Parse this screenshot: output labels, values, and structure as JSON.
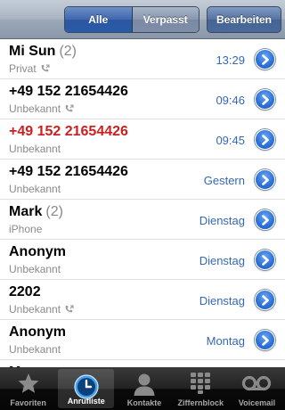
{
  "navbar": {
    "segment_all": "Alle",
    "segment_missed": "Verpasst",
    "edit_label": "Bearbeiten"
  },
  "calls": [
    {
      "name": "Mi Sun",
      "count": "(2)",
      "label": "Privat",
      "time": "13:29",
      "missed": false,
      "outgoing": true
    },
    {
      "name": "+49 152 21654426",
      "count": "",
      "label": "Unbekannt",
      "time": "09:46",
      "missed": false,
      "outgoing": true
    },
    {
      "name": "+49 152 21654426",
      "count": "",
      "label": "Unbekannt",
      "time": "09:45",
      "missed": true,
      "outgoing": false
    },
    {
      "name": "+49 152 21654426",
      "count": "",
      "label": "Unbekannt",
      "time": "Gestern",
      "missed": false,
      "outgoing": false
    },
    {
      "name": "Mark",
      "count": "(2)",
      "label": "iPhone",
      "time": "Dienstag",
      "missed": false,
      "outgoing": false
    },
    {
      "name": "Anonym",
      "count": "",
      "label": "Unbekannt",
      "time": "Dienstag",
      "missed": false,
      "outgoing": false
    },
    {
      "name": "2202",
      "count": "",
      "label": "Unbekannt",
      "time": "Dienstag",
      "missed": false,
      "outgoing": true
    },
    {
      "name": "Anonym",
      "count": "",
      "label": "Unbekannt",
      "time": "Montag",
      "missed": false,
      "outgoing": false
    },
    {
      "name": "Mama",
      "count": "",
      "label": "",
      "time": "",
      "missed": false,
      "outgoing": false
    }
  ],
  "tabs": [
    {
      "label": "Favoriten",
      "icon": "star-icon",
      "active": false
    },
    {
      "label": "Anrufliste",
      "icon": "clock-icon",
      "active": true
    },
    {
      "label": "Kontakte",
      "icon": "person-icon",
      "active": false
    },
    {
      "label": "Ziffernblock",
      "icon": "keypad-icon",
      "active": false
    },
    {
      "label": "Voicemail",
      "icon": "voicemail-icon",
      "active": false
    }
  ],
  "colors": {
    "missed": "#cc1f1f",
    "time": "#3668b4",
    "disclosure": "#2f73d8"
  }
}
